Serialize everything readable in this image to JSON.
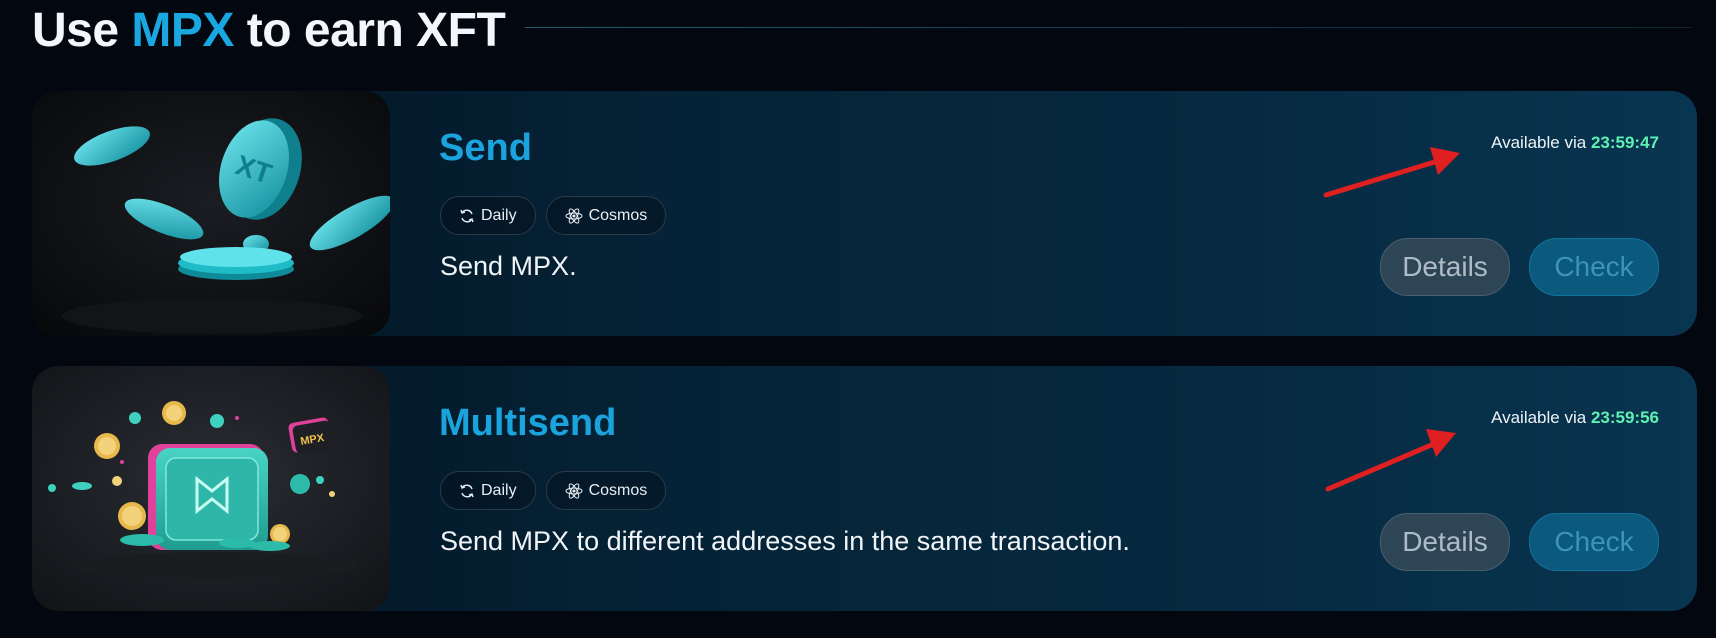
{
  "header": {
    "title_prefix": "Use ",
    "title_accent": "MPX",
    "title_suffix": " to earn XFT"
  },
  "tasks": [
    {
      "title": "Send",
      "tags": [
        {
          "label": "Daily",
          "icon": "refresh-icon"
        },
        {
          "label": "Cosmos",
          "icon": "cosmos-icon"
        }
      ],
      "description": "Send MPX.",
      "availability_label": "Available via",
      "availability_time": "23:59:47",
      "details_label": "Details",
      "check_label": "Check"
    },
    {
      "title": "Multisend",
      "tags": [
        {
          "label": "Daily",
          "icon": "refresh-icon"
        },
        {
          "label": "Cosmos",
          "icon": "cosmos-icon"
        }
      ],
      "description": "Send MPX to different addresses in the same transaction.",
      "availability_label": "Available via",
      "availability_time": "23:59:56",
      "details_label": "Details",
      "check_label": "Check"
    }
  ],
  "colors": {
    "accent": "#1aa6e0",
    "timer": "#5ff0b2",
    "annotation_arrow": "#e02020"
  }
}
